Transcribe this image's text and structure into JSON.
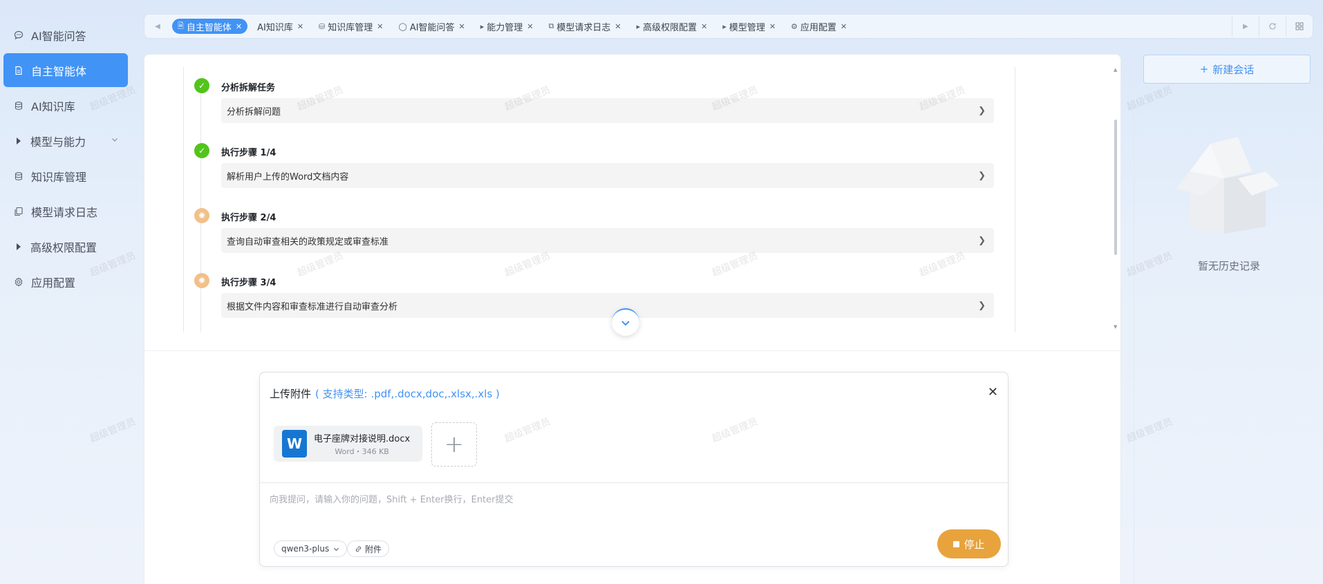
{
  "sidebar": {
    "items": [
      {
        "label": "AI智能问答",
        "icon": "chat-icon"
      },
      {
        "label": "自主智能体",
        "icon": "document-icon",
        "active": true
      },
      {
        "label": "AI知识库",
        "icon": "database-icon"
      },
      {
        "label": "模型与能力",
        "icon": "triangle-right-icon",
        "expandable": true
      },
      {
        "label": "知识库管理",
        "icon": "database-icon"
      },
      {
        "label": "模型请求日志",
        "icon": "copy-icon"
      },
      {
        "label": "高级权限配置",
        "icon": "triangle-right-icon"
      },
      {
        "label": "应用配置",
        "icon": "gear-icon"
      }
    ]
  },
  "tabs": [
    {
      "label": "自主智能体",
      "icon": "document-icon",
      "active": true
    },
    {
      "label": "AI知识库",
      "icon": ""
    },
    {
      "label": "知识库管理",
      "icon": "database-icon"
    },
    {
      "label": "AI智能问答",
      "icon": "chat-icon"
    },
    {
      "label": "能力管理",
      "icon": "triangle-right-icon"
    },
    {
      "label": "模型请求日志",
      "icon": "copy-icon"
    },
    {
      "label": "高级权限配置",
      "icon": "triangle-right-icon"
    },
    {
      "label": "模型管理",
      "icon": "triangle-right-icon"
    },
    {
      "label": "应用配置",
      "icon": "gear-icon"
    }
  ],
  "steps": [
    {
      "title": "分析拆解任务",
      "desc": "分析拆解问题",
      "status": "done"
    },
    {
      "title": "执行步骤 1/4",
      "desc": "解析用户上传的Word文档内容",
      "status": "done"
    },
    {
      "title": "执行步骤 2/4",
      "desc": "查询自动审查相关的政策规定或审查标准",
      "status": "pending"
    },
    {
      "title": "执行步骤 3/4",
      "desc": "根据文件内容和审查标准进行自动审查分析",
      "status": "pending"
    }
  ],
  "composer": {
    "upload_title": "上传附件",
    "upload_types": "( 支持类型: .pdf,.docx,doc,.xlsx,.xls )",
    "file": {
      "name": "电子座牌对接说明.docx",
      "meta": "Word・346 KB"
    },
    "placeholder": "向我提问，请输入你的问题，Shift + Enter换行，Enter提交",
    "model": "qwen3-plus",
    "attach_label": "附件",
    "stop_label": "停止"
  },
  "right_panel": {
    "new_chat_label": "新建会话",
    "empty_text": "暂无历史记录"
  },
  "watermark": "超级管理员",
  "colors": {
    "accent": "#4193f5",
    "stop": "#e8a33d",
    "done": "#52c41a",
    "pending": "#f2c089"
  }
}
